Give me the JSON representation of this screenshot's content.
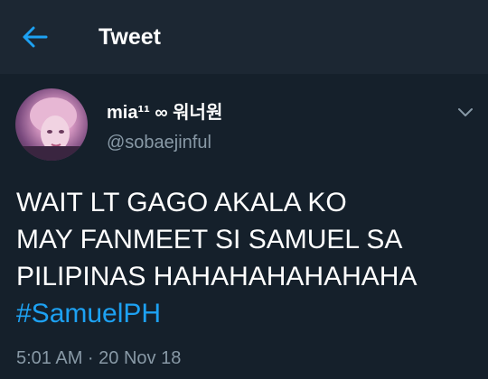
{
  "header": {
    "title": "Tweet",
    "back_icon": "arrow-left-icon"
  },
  "tweet": {
    "display_name": "mia¹¹ ∞ 워너원",
    "username": "@sobaejinful",
    "text_lines": [
      "WAIT LT GAGO AKALA KO",
      "MAY FANMEET SI SAMUEL SA",
      "PILIPINAS HAHAHAHAHAHAHA"
    ],
    "hashtag": "#SamuelPH",
    "timestamp": "5:01 AM · 20 Nov 18",
    "menu_icon": "chevron-down-icon"
  },
  "colors": {
    "background": "#15202b",
    "header_background": "#1c2733",
    "accent": "#1da1f2",
    "secondary_text": "#8899a6",
    "primary_text": "#ffffff"
  }
}
